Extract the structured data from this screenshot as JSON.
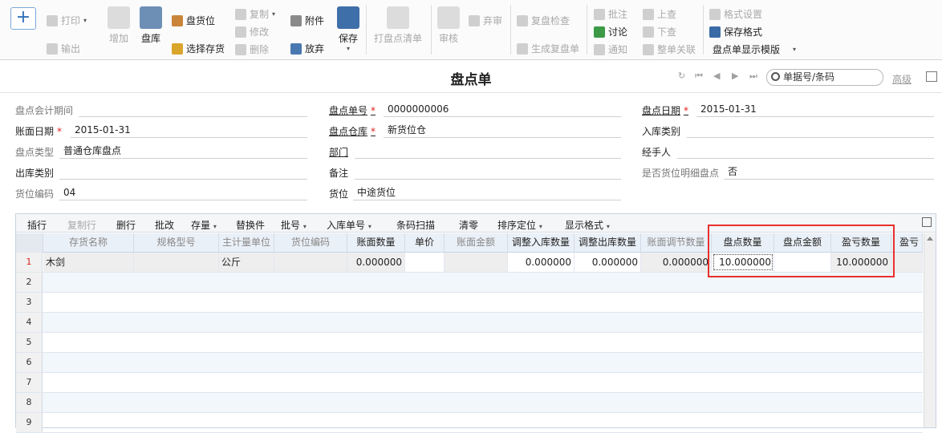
{
  "toolbar": {
    "print": "打印",
    "export": "输出",
    "add": "增加",
    "stocktake": "盘库",
    "location": "盘货位",
    "select_inventory": "选择存货",
    "copy": "复制",
    "modify": "修改",
    "delete": "删除",
    "attachment": "附件",
    "discard": "放弃",
    "save": "保存",
    "print_list": "打盘点清单",
    "audit": "审核",
    "abandon": "弃审",
    "recheck": "复盘检查",
    "gen_recheck": "生成复盘单",
    "annotate": "批注",
    "discuss": "讨论",
    "notify": "通知",
    "prev": "上查",
    "next": "下查",
    "whole_link": "整单关联",
    "format_setting": "格式设置",
    "save_format": "保存格式",
    "template": "盘点单显示模版"
  },
  "header": {
    "title": "盘点单",
    "search_placeholder": "单据号/条码",
    "advanced": "高级"
  },
  "form": {
    "period_label": "盘点会计期间",
    "period_value": "",
    "bill_no_label": "盘点单号",
    "bill_no_value": "0000000006",
    "date_label": "盘点日期",
    "date_value": "2015-01-31",
    "book_date_label": "账面日期",
    "book_date_value": "2015-01-31",
    "warehouse_label": "盘点仓库",
    "warehouse_value": "新货位仓",
    "in_type_label": "入库类别",
    "in_type_value": "",
    "check_type_label": "盘点类型",
    "check_type_value": "普通仓库盘点",
    "dept_label": "部门",
    "dept_value": "",
    "handler_label": "经手人",
    "handler_value": "",
    "out_type_label": "出库类别",
    "out_type_value": "",
    "remark_label": "备注",
    "remark_value": "",
    "detail_label": "是否货位明细盘点",
    "detail_value": "否",
    "loc_code_label": "货位编码",
    "loc_code_value": "04",
    "location_label": "货位",
    "location_value": "中途货位"
  },
  "grid_toolbar": {
    "insert": "插行",
    "copy_row": "复制行",
    "del_row": "删行",
    "batch_edit": "批改",
    "stock": "存量",
    "substitute": "替换件",
    "lot": "批号",
    "in_bill": "入库单号",
    "barcode": "条码扫描",
    "clear_zero": "清零",
    "sort": "排序定位",
    "display_format": "显示格式"
  },
  "columns": [
    "存货名称",
    "规格型号",
    "主计量单位",
    "货位编码",
    "账面数量",
    "单价",
    "账面金额",
    "调整入库数量",
    "调整出库数量",
    "账面调节数量",
    "盘点数量",
    "盘点金额",
    "盈亏数量",
    "盈亏"
  ],
  "rows": [
    {
      "no": "1",
      "name": "木剑",
      "spec": "",
      "unit": "公斤",
      "loc": "",
      "book_qty": "0.000000",
      "price": "",
      "book_amt": "",
      "adj_in": "0.000000",
      "adj_out": "0.000000",
      "adj_book": "0.000000",
      "check_qty": "10.000000",
      "check_amt": "",
      "diff_qty": "10.000000"
    },
    {
      "no": "2"
    },
    {
      "no": "3"
    },
    {
      "no": "4"
    },
    {
      "no": "5"
    },
    {
      "no": "6"
    },
    {
      "no": "7"
    },
    {
      "no": "8"
    },
    {
      "no": "9"
    }
  ]
}
